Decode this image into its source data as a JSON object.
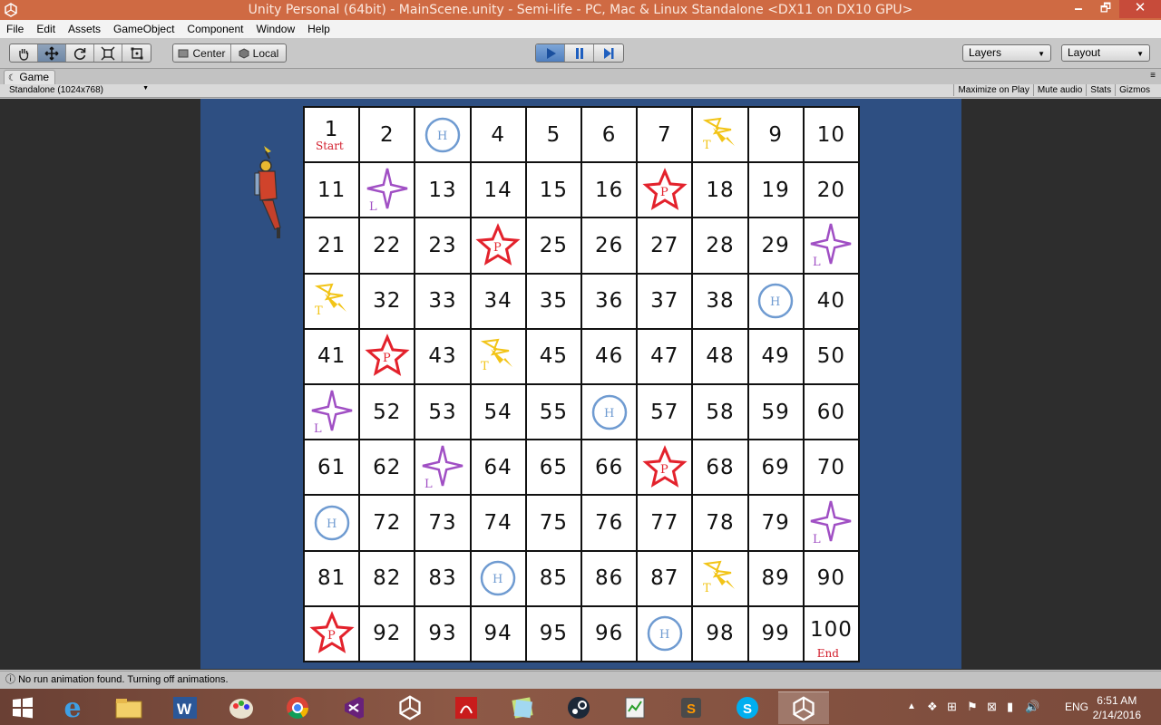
{
  "window": {
    "title": "Unity Personal (64bit) - MainScene.unity - Semi-life - PC, Mac & Linux Standalone <DX11 on DX10 GPU>",
    "minimize": "🗕",
    "restore": "🗗",
    "close": "✕"
  },
  "menu": [
    "File",
    "Edit",
    "Assets",
    "GameObject",
    "Component",
    "Window",
    "Help"
  ],
  "toolbar": {
    "pivot_label": "Center",
    "space_label": "Local",
    "layers_label": "Layers",
    "layout_label": "Layout"
  },
  "game_panel": {
    "tab_label": "Game",
    "aspect_label": "Standalone (1024x768)",
    "maximize_label": "Maximize on Play",
    "mute_label": "Mute audio",
    "stats_label": "Stats",
    "gizmos_label": "Gizmos"
  },
  "board": {
    "start_label": "Start",
    "end_label": "End",
    "cells": [
      {
        "n": "1",
        "icon": ""
      },
      {
        "n": "2",
        "icon": ""
      },
      {
        "n": "",
        "icon": "H"
      },
      {
        "n": "4",
        "icon": ""
      },
      {
        "n": "5",
        "icon": ""
      },
      {
        "n": "6",
        "icon": ""
      },
      {
        "n": "7",
        "icon": ""
      },
      {
        "n": "",
        "icon": "T"
      },
      {
        "n": "9",
        "icon": ""
      },
      {
        "n": "10",
        "icon": ""
      },
      {
        "n": "11",
        "icon": ""
      },
      {
        "n": "",
        "icon": "L"
      },
      {
        "n": "13",
        "icon": ""
      },
      {
        "n": "14",
        "icon": ""
      },
      {
        "n": "15",
        "icon": ""
      },
      {
        "n": "16",
        "icon": ""
      },
      {
        "n": "",
        "icon": "P"
      },
      {
        "n": "18",
        "icon": ""
      },
      {
        "n": "19",
        "icon": ""
      },
      {
        "n": "20",
        "icon": ""
      },
      {
        "n": "21",
        "icon": ""
      },
      {
        "n": "22",
        "icon": ""
      },
      {
        "n": "23",
        "icon": ""
      },
      {
        "n": "",
        "icon": "P"
      },
      {
        "n": "25",
        "icon": ""
      },
      {
        "n": "26",
        "icon": ""
      },
      {
        "n": "27",
        "icon": ""
      },
      {
        "n": "28",
        "icon": ""
      },
      {
        "n": "29",
        "icon": ""
      },
      {
        "n": "",
        "icon": "L"
      },
      {
        "n": "",
        "icon": "T"
      },
      {
        "n": "32",
        "icon": ""
      },
      {
        "n": "33",
        "icon": ""
      },
      {
        "n": "34",
        "icon": ""
      },
      {
        "n": "35",
        "icon": ""
      },
      {
        "n": "36",
        "icon": ""
      },
      {
        "n": "37",
        "icon": ""
      },
      {
        "n": "38",
        "icon": ""
      },
      {
        "n": "",
        "icon": "H"
      },
      {
        "n": "40",
        "icon": ""
      },
      {
        "n": "41",
        "icon": ""
      },
      {
        "n": "",
        "icon": "P"
      },
      {
        "n": "43",
        "icon": ""
      },
      {
        "n": "",
        "icon": "T"
      },
      {
        "n": "45",
        "icon": ""
      },
      {
        "n": "46",
        "icon": ""
      },
      {
        "n": "47",
        "icon": ""
      },
      {
        "n": "48",
        "icon": ""
      },
      {
        "n": "49",
        "icon": ""
      },
      {
        "n": "50",
        "icon": ""
      },
      {
        "n": "",
        "icon": "L"
      },
      {
        "n": "52",
        "icon": ""
      },
      {
        "n": "53",
        "icon": ""
      },
      {
        "n": "54",
        "icon": ""
      },
      {
        "n": "55",
        "icon": ""
      },
      {
        "n": "",
        "icon": "H"
      },
      {
        "n": "57",
        "icon": ""
      },
      {
        "n": "58",
        "icon": ""
      },
      {
        "n": "59",
        "icon": ""
      },
      {
        "n": "60",
        "icon": ""
      },
      {
        "n": "61",
        "icon": ""
      },
      {
        "n": "62",
        "icon": ""
      },
      {
        "n": "",
        "icon": "L"
      },
      {
        "n": "64",
        "icon": ""
      },
      {
        "n": "65",
        "icon": ""
      },
      {
        "n": "66",
        "icon": ""
      },
      {
        "n": "",
        "icon": "P"
      },
      {
        "n": "68",
        "icon": ""
      },
      {
        "n": "69",
        "icon": ""
      },
      {
        "n": "70",
        "icon": ""
      },
      {
        "n": "",
        "icon": "H"
      },
      {
        "n": "72",
        "icon": ""
      },
      {
        "n": "73",
        "icon": ""
      },
      {
        "n": "74",
        "icon": ""
      },
      {
        "n": "75",
        "icon": ""
      },
      {
        "n": "76",
        "icon": ""
      },
      {
        "n": "77",
        "icon": ""
      },
      {
        "n": "78",
        "icon": ""
      },
      {
        "n": "79",
        "icon": ""
      },
      {
        "n": "",
        "icon": "L"
      },
      {
        "n": "81",
        "icon": ""
      },
      {
        "n": "82",
        "icon": ""
      },
      {
        "n": "83",
        "icon": ""
      },
      {
        "n": "",
        "icon": "H"
      },
      {
        "n": "85",
        "icon": ""
      },
      {
        "n": "86",
        "icon": ""
      },
      {
        "n": "87",
        "icon": ""
      },
      {
        "n": "",
        "icon": "T"
      },
      {
        "n": "89",
        "icon": ""
      },
      {
        "n": "90",
        "icon": ""
      },
      {
        "n": "",
        "icon": "P"
      },
      {
        "n": "92",
        "icon": ""
      },
      {
        "n": "93",
        "icon": ""
      },
      {
        "n": "94",
        "icon": ""
      },
      {
        "n": "95",
        "icon": ""
      },
      {
        "n": "96",
        "icon": ""
      },
      {
        "n": "",
        "icon": "H"
      },
      {
        "n": "98",
        "icon": ""
      },
      {
        "n": "99",
        "icon": ""
      },
      {
        "n": "100",
        "icon": ""
      }
    ],
    "icon_colors": {
      "H": "#6f9bd1",
      "L": "#a04fc4",
      "P": "#e3222c",
      "T": "#f2c417"
    }
  },
  "status": {
    "message": "No run animation found. Turning off animations."
  },
  "taskbar": {
    "lang": "ENG",
    "time": "6:51 AM",
    "date": "2/14/2016"
  }
}
